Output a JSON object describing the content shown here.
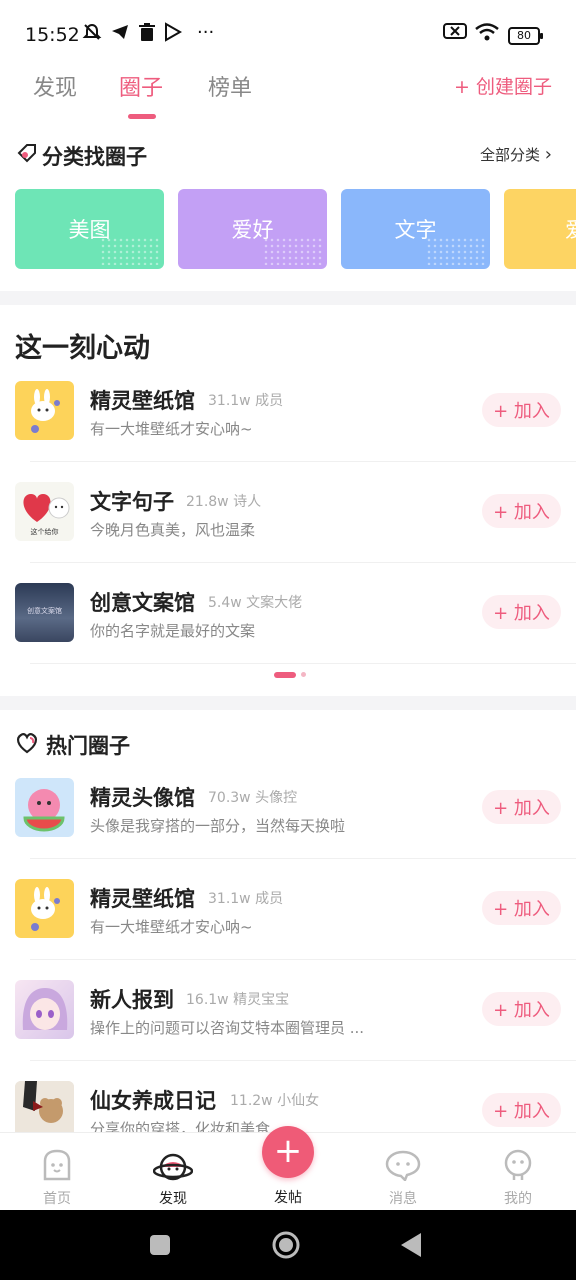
{
  "status_bar": {
    "time": "15:52",
    "more": "···",
    "battery": "80"
  },
  "tabs": [
    {
      "label": "发现",
      "active": false
    },
    {
      "label": "圈子",
      "active": true
    },
    {
      "label": "榜单",
      "active": false
    }
  ],
  "create_circle": "+ 创建圈子",
  "category_section": {
    "title": "分类找圈子",
    "all_label": "全部分类",
    "categories": [
      {
        "label": "美图",
        "color": "#6ee5b6"
      },
      {
        "label": "爱好",
        "color": "#c3a0f5"
      },
      {
        "label": "文字",
        "color": "#8ab7fb"
      },
      {
        "label": "爱",
        "color": "#fdd463"
      }
    ]
  },
  "heartbeat_section": {
    "title": "这一刻心动",
    "items": [
      {
        "name": "精灵壁纸馆",
        "members": "31.1w 成员",
        "desc": "有一大堆壁纸才安心呐~",
        "join": "+ 加入"
      },
      {
        "name": "文字句子",
        "members": "21.8w 诗人",
        "desc": "今晚月色真美，风也温柔",
        "join": "+ 加入",
        "avatar_caption": "这个给你"
      },
      {
        "name": "创意文案馆",
        "members": "5.4w 文案大佬",
        "desc": "你的名字就是最好的文案",
        "join": "+ 加入",
        "avatar_caption": "创意文案馆"
      }
    ]
  },
  "hot_section": {
    "title": "热门圈子",
    "items": [
      {
        "name": "精灵头像馆",
        "members": "70.3w 头像控",
        "desc": "头像是我穿搭的一部分，当然每天换啦",
        "join": "+ 加入"
      },
      {
        "name": "精灵壁纸馆",
        "members": "31.1w 成员",
        "desc": "有一大堆壁纸才安心呐~",
        "join": "+ 加入"
      },
      {
        "name": "新人报到",
        "members": "16.1w 精灵宝宝",
        "desc": "操作上的问题可以咨询艾特本圈管理员 ...",
        "join": "+ 加入"
      },
      {
        "name": "仙女养成日记",
        "members": "11.2w 小仙女",
        "desc": "分享你的穿搭，化妆和美食",
        "join": "+ 加入"
      }
    ]
  },
  "bottom_nav": {
    "items": [
      {
        "label": "首页",
        "icon": "home-ghost-icon",
        "active": false
      },
      {
        "label": "发现",
        "icon": "discover-planet-icon",
        "active": true
      },
      {
        "label": "消息",
        "icon": "message-bubble-icon",
        "active": false
      },
      {
        "label": "我的",
        "icon": "profile-icon",
        "active": false
      }
    ],
    "post_label": "发帖",
    "post_icon": "+"
  },
  "colors": {
    "accent": "#ee5c7e"
  }
}
